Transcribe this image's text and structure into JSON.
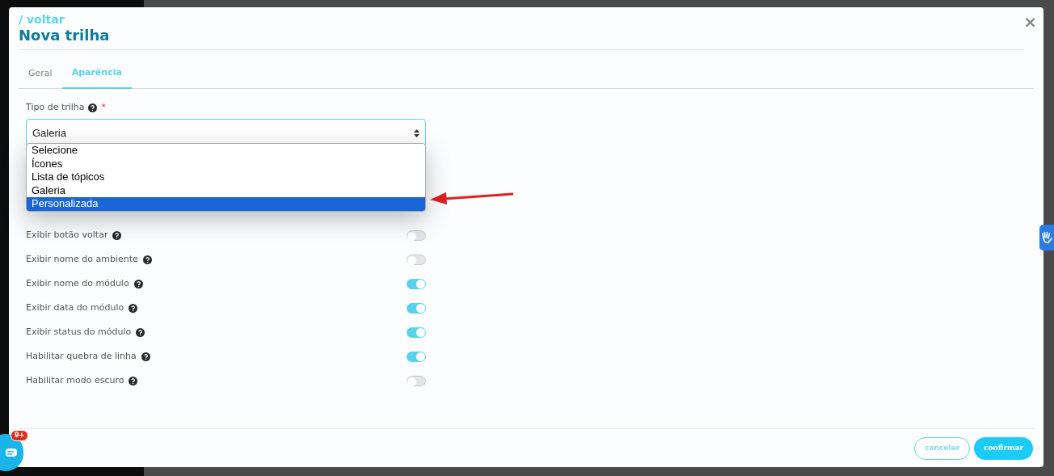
{
  "modal": {
    "back_link": "/ voltar",
    "title": "Nova trilha",
    "close": "×"
  },
  "tabs": [
    {
      "label": "Geral",
      "selected": false
    },
    {
      "label": "Aparência",
      "selected": true
    }
  ],
  "field": {
    "label": "Tipo de trilha",
    "required": "*",
    "value": "Galeria",
    "expanded": true,
    "options": [
      {
        "label": "Selecione",
        "highlighted": false
      },
      {
        "label": "Ícones",
        "highlighted": false
      },
      {
        "label": "Lista de tópicos",
        "highlighted": false
      },
      {
        "label": "Galeria",
        "highlighted": false
      },
      {
        "label": "Personalizada",
        "highlighted": true
      }
    ]
  },
  "toggles": [
    {
      "label": "Exibir botão voltar",
      "on": false
    },
    {
      "label": "Exibir nome do ambiente",
      "on": false
    },
    {
      "label": "Exibir nome do módulo",
      "on": true
    },
    {
      "label": "Exibir data do módulo",
      "on": true
    },
    {
      "label": "Exibir status do módulo",
      "on": true
    },
    {
      "label": "Habilitar quebra de linha",
      "on": true
    },
    {
      "label": "Habilitar modo escuro",
      "on": false
    }
  ],
  "buttons": [
    {
      "label": "cancelar",
      "kind": "outline"
    },
    {
      "label": "confirmar",
      "kind": "primary"
    }
  ],
  "chat_badge": "9+"
}
